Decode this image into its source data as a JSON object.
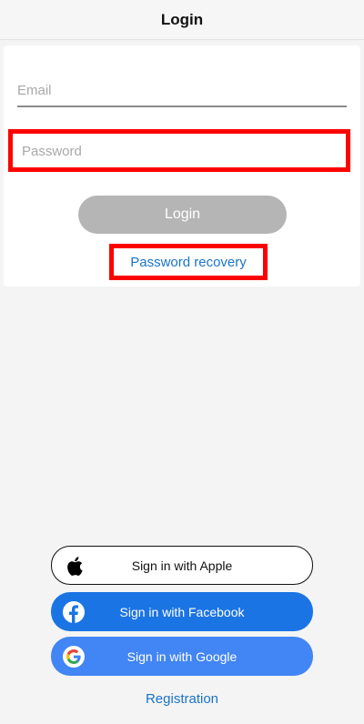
{
  "nav": {
    "title": "Login"
  },
  "form": {
    "email_placeholder": "Email",
    "password_placeholder": "Password",
    "login_label": "Login",
    "recovery_label": "Password recovery"
  },
  "social": {
    "apple_label": "Sign in with Apple",
    "facebook_label": "Sign in with Facebook",
    "google_label": "Sign in with Google"
  },
  "footer": {
    "registration_label": "Registration"
  },
  "colors": {
    "highlight": "#ff0000",
    "link": "#1a73c9",
    "login_disabled": "#b5b5b5",
    "facebook": "#1b74e4",
    "google": "#4285f4"
  },
  "icons": {
    "apple": "apple-logo-icon",
    "facebook": "facebook-logo-icon",
    "google": "google-logo-icon"
  }
}
